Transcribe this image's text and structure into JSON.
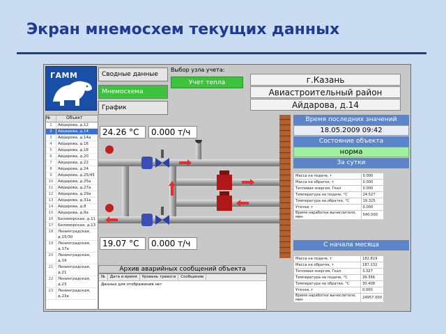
{
  "slide": {
    "title": "Экран мнемосхем текущих данных"
  },
  "logo": {
    "text": "ГАММ"
  },
  "nav": {
    "items": [
      "Сводные данные",
      "Мнемосхема",
      "График"
    ],
    "active": "Мнемосхема"
  },
  "node": {
    "label": "Выбор узла учета:",
    "button": "Учет тепла"
  },
  "address": {
    "city": "г.Казань",
    "district": "Авиастроительный район",
    "street": "Айдарова, д.14"
  },
  "objects": {
    "header": [
      "№",
      "Объект"
    ],
    "rows": [
      [
        "1",
        "Айдарова, д.12"
      ],
      [
        "2",
        "Айдарова, д.14"
      ],
      [
        "3",
        "Айдарова, д.14а"
      ],
      [
        "4",
        "Айдарова, д.16"
      ],
      [
        "5",
        "Айдарова, д.18"
      ],
      [
        "6",
        "Айдарова, д.20"
      ],
      [
        "7",
        "Айдарова, д.22"
      ],
      [
        "8",
        "Айдарова, д.24"
      ],
      [
        "9",
        "Айдарова, д.25/45"
      ],
      [
        "10",
        "Айдарова, д.25а"
      ],
      [
        "11",
        "Айдарова, д.27а"
      ],
      [
        "12",
        "Айдарова, д.29а"
      ],
      [
        "13",
        "Айдарова, д.31а"
      ],
      [
        "14",
        "Айдарова, д.8"
      ],
      [
        "15",
        "Айдарова, д.8а"
      ],
      [
        "16",
        "Беломорская, д.11"
      ],
      [
        "17",
        "Беломорская, д.13"
      ],
      [
        "18",
        "Ленинградская, д.15/30"
      ],
      [
        "19",
        "Ленинградская, д.17а"
      ],
      [
        "20",
        "Ленинградская, д.19"
      ],
      [
        "21",
        "Ленинградская, д.21"
      ],
      [
        "22",
        "Ленинградская, д.23"
      ],
      [
        "23",
        "Ленинградская, д.23а"
      ]
    ],
    "selected": 1
  },
  "supply": {
    "temp": "24.26 °C",
    "mass": "0.000 т/ч"
  },
  "return": {
    "temp": "19.07 °C",
    "mass": "0.000 т/ч"
  },
  "last_values": {
    "header": "Время последних значений",
    "value": "18.05.2009 09:42"
  },
  "state": {
    "header": "Состояние объекта",
    "value": "норма"
  },
  "per_day": {
    "header": "За сутки",
    "rows": [
      [
        "Масса на подаче, т",
        "0.000"
      ],
      [
        "Масса на обратке, т",
        "0.000"
      ],
      [
        "Тепловая энергия, Гкал",
        "0.000"
      ],
      [
        "Температура на подаче, °C",
        "24.527"
      ],
      [
        "Температура на обратке, °C",
        "19.325"
      ],
      [
        "Утечки, т",
        "0.000"
      ],
      [
        "Время наработки вычислителя, мин",
        "540.000"
      ]
    ]
  },
  "per_month": {
    "header": "С начала месяца",
    "rows": [
      [
        "Масса на подаче, т",
        "182.819"
      ],
      [
        "Масса на обратке, т",
        "187.132"
      ],
      [
        "Тепловая энергия, Гкал",
        "3.327"
      ],
      [
        "Температура на подаче, °C",
        "39.356"
      ],
      [
        "Температура на обратке, °C",
        "30.408"
      ],
      [
        "Утечки, т",
        "0.000"
      ],
      [
        "Время наработки вычислителя, мин",
        "24957.000"
      ]
    ]
  },
  "archive": {
    "title": "Архив аварийных сообщений объекта",
    "columns": [
      "№",
      "Дата и время",
      "Уровень тревоги",
      "Сообщение"
    ],
    "message": "Данных для отображения нет"
  },
  "colors": {
    "accent": "#1f3a93",
    "nav_active": "#3cc23c",
    "panel_header": "#5b85c8",
    "state_ok": "#9ff09f"
  }
}
